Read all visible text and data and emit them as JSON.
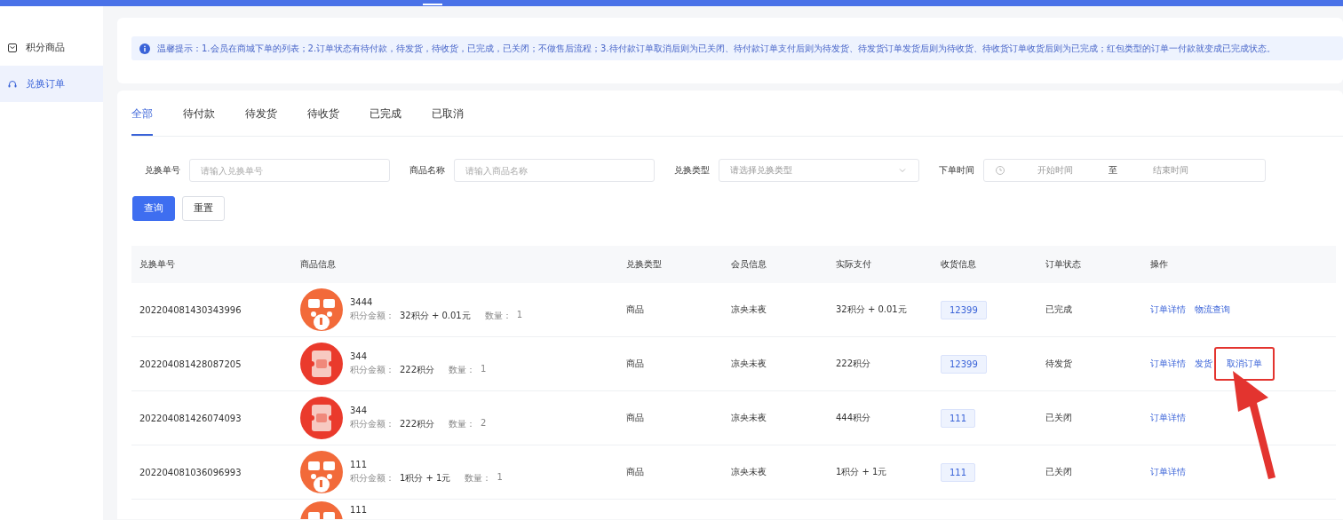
{
  "sidebar": {
    "items": [
      {
        "label": "积分商品",
        "selected": false
      },
      {
        "label": "兑换订单",
        "selected": true
      }
    ]
  },
  "notice": {
    "text": "温馨提示：1.会员在商城下单的列表；2.订单状态有待付款，待发货，待收货，已完成，已关闭；不做售后流程；3.待付款订单取消后则为已关闭、待付款订单支付后则为待发货、待发货订单发货后则为待收货、待收货订单收货后则为已完成；红包类型的订单一付款就变成已完成状态。"
  },
  "tabs": [
    {
      "label": "全部",
      "selected": true
    },
    {
      "label": "待付款",
      "selected": false
    },
    {
      "label": "待发货",
      "selected": false
    },
    {
      "label": "待收货",
      "selected": false
    },
    {
      "label": "已完成",
      "selected": false
    },
    {
      "label": "已取消",
      "selected": false
    }
  ],
  "filters": [
    {
      "kind": "input",
      "label": "兑换单号",
      "placeholder": "请输入兑换单号"
    },
    {
      "kind": "input",
      "label": "商品名称",
      "placeholder": "请输入商品名称"
    },
    {
      "kind": "select",
      "label": "兑换类型",
      "placeholder": "请选择兑换类型"
    },
    {
      "kind": "daterange",
      "label": "下单时间",
      "placeholder": "开始时间",
      "separator": "至",
      "placeholder_end": "结束时间"
    }
  ],
  "buttons": [
    {
      "label": "查询",
      "primary": true
    },
    {
      "label": "重置",
      "primary": false
    }
  ],
  "table": {
    "columns": [
      "兑换单号",
      "商品信息",
      "兑换类型",
      "会员信息",
      "实际支付",
      "收货信息",
      "订单状态",
      "操作"
    ],
    "rows": [
      {
        "order_no": "202204081430343996",
        "image": {
          "kind": "flash-sale"
        },
        "name": "3444",
        "amount_label": "积分金额：",
        "amount": "32积分 + 0.01元",
        "qty_label": "数量：",
        "qty": "1",
        "type": "商品",
        "member": "凉央未夜",
        "paid": "32积分 + 0.01元",
        "receiver": "12399",
        "status": "已完成",
        "actions": [
          {
            "label": "订单详情",
            "highlighted": false
          },
          {
            "label": "物流查询",
            "highlighted": false
          }
        ]
      },
      {
        "order_no": "202204081428087205",
        "image": {
          "kind": "coupon"
        },
        "name": "344",
        "amount_label": "积分金额：",
        "amount": "222积分",
        "qty_label": "数量：",
        "qty": "1",
        "type": "商品",
        "member": "凉央未夜",
        "paid": "222积分",
        "receiver": "12399",
        "status": "待发货",
        "actions": [
          {
            "label": "订单详情",
            "highlighted": false
          },
          {
            "label": "发货",
            "highlighted": false
          },
          {
            "label": "取消订单",
            "highlighted": true
          }
        ]
      },
      {
        "order_no": "202204081426074093",
        "image": {
          "kind": "coupon"
        },
        "name": "344",
        "amount_label": "积分金额：",
        "amount": "222积分",
        "qty_label": "数量：",
        "qty": "2",
        "type": "商品",
        "member": "凉央未夜",
        "paid": "444积分",
        "receiver": "111",
        "status": "已关闭",
        "actions": [
          {
            "label": "订单详情",
            "highlighted": false
          }
        ]
      },
      {
        "order_no": "202204081036096993",
        "image": {
          "kind": "flash-sale"
        },
        "name": "111",
        "amount_label": "积分金额：",
        "amount": "1积分 + 1元",
        "qty_label": "数量：",
        "qty": "1",
        "type": "商品",
        "member": "凉央未夜",
        "paid": "1积分 + 1元",
        "receiver": "111",
        "status": "已关闭",
        "actions": [
          {
            "label": "订单详情",
            "highlighted": false
          }
        ]
      },
      {
        "image": {
          "kind": "flash-sale"
        },
        "name": "111"
      }
    ]
  }
}
